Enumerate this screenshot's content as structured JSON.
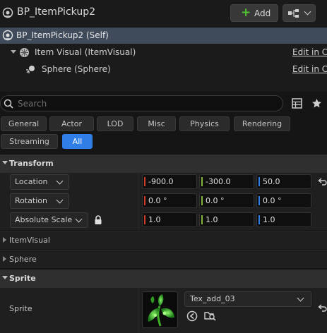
{
  "header": {
    "title": "BP_ItemPickup2",
    "add_button": {
      "icon": "plus-icon",
      "label": "Add"
    },
    "options_button": {
      "icon": "blueprint-options-icon"
    }
  },
  "components": {
    "self_label": "BP_ItemPickup2 (Self)",
    "items": [
      {
        "label": "Item Visual (ItemVisual)",
        "edit": "Edit in C++"
      },
      {
        "label": "Sphere (Sphere)",
        "edit": "Edit in C++"
      }
    ]
  },
  "search": {
    "placeholder": "Search",
    "value": ""
  },
  "filters": {
    "row1": [
      "General",
      "Actor",
      "LOD",
      "Misc",
      "Physics",
      "Rendering"
    ],
    "row2": [
      "Streaming",
      "All"
    ],
    "active": "All"
  },
  "transform": {
    "title": "Transform",
    "location": {
      "label": "Location",
      "x": "-900.0",
      "y": "-300.0",
      "z": "50.0"
    },
    "rotation": {
      "label": "Rotation",
      "x": "0.0 °",
      "y": "0.0 °",
      "z": "0.0 °"
    },
    "scale": {
      "label": "Absolute Scale",
      "x": "1.0",
      "y": "1.0",
      "z": "1.0"
    }
  },
  "collapsed": {
    "item_visual": "ItemVisual",
    "sphere": "Sphere"
  },
  "sprite_section": {
    "title": "Sprite",
    "property_label": "Sprite",
    "asset": "Tex_add_03"
  },
  "colors": {
    "accent": "#2f7fe6",
    "x_axis": "#d13b2b",
    "y_axis": "#7fb33a",
    "z_axis": "#2f7fe6",
    "add_green": "#4ec52f",
    "selected_row": "#3f4a5b"
  }
}
